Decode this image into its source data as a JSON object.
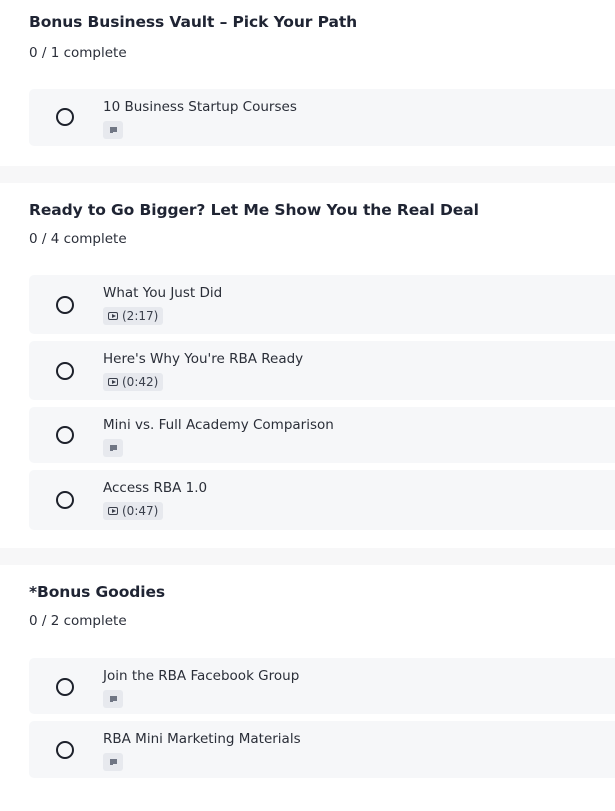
{
  "sections": [
    {
      "title": "Bonus Business Vault – Pick Your Path",
      "progress": "0 / 1 complete",
      "lessons": [
        {
          "title": "10 Business Startup Courses",
          "type": "document"
        }
      ]
    },
    {
      "title": "Ready to Go Bigger? Let Me Show You the Real Deal",
      "progress": "0 / 4 complete",
      "lessons": [
        {
          "title": "What You Just Did",
          "type": "video",
          "duration": "(2:17)"
        },
        {
          "title": "Here's Why You're RBA Ready",
          "type": "video",
          "duration": "(0:42)"
        },
        {
          "title": "Mini vs. Full Academy Comparison",
          "type": "document"
        },
        {
          "title": "Access RBA 1.0",
          "type": "video",
          "duration": "(0:47)"
        }
      ]
    },
    {
      "title": "*Bonus Goodies",
      "progress": "0 / 2 complete",
      "lessons": [
        {
          "title": "Join the RBA Facebook Group",
          "type": "document"
        },
        {
          "title": "RBA Mini Marketing Materials",
          "type": "document"
        }
      ]
    }
  ],
  "icons": {
    "incomplete": "empty-circle-icon",
    "document": "document-icon",
    "video": "video-play-icon"
  },
  "colors": {
    "page_bg": "#f7f7f8",
    "card_bg": "#ffffff",
    "lesson_bg": "#f6f7f9",
    "badge_bg": "#e7e9ee",
    "text": "#1f2433"
  }
}
